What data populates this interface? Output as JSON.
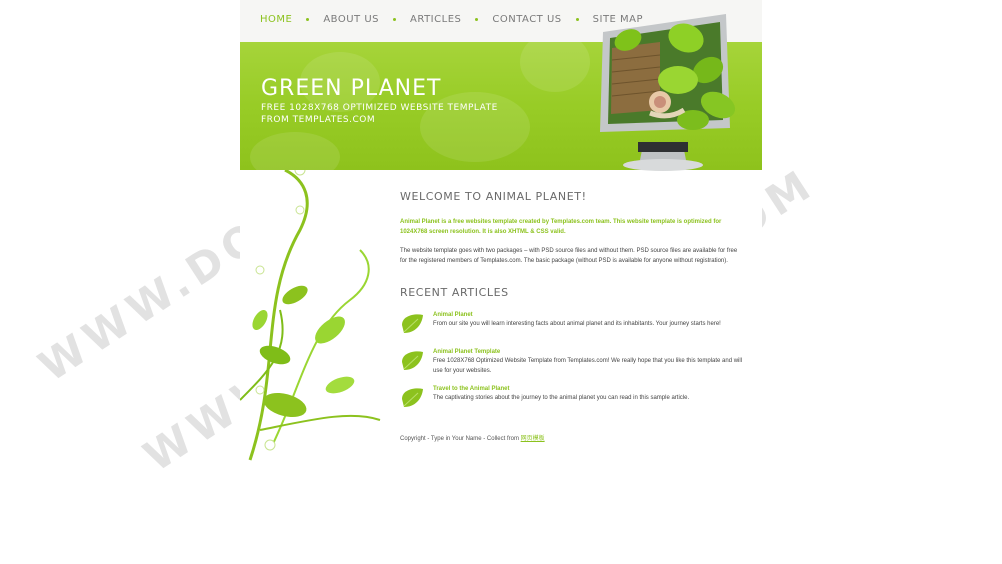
{
  "nav": {
    "items": [
      {
        "label": "HOME"
      },
      {
        "label": "ABOUT US"
      },
      {
        "label": "ARTICLES"
      },
      {
        "label": "CONTACT US"
      },
      {
        "label": "SITE MAP"
      }
    ]
  },
  "header": {
    "title": "GREEN PLANET",
    "subtitle_line1": "FREE 1028X768 OPTIMIZED WEBSITE TEMPLATE",
    "subtitle_line2": "FROM TEMPLATES.COM"
  },
  "welcome": {
    "heading": "WELCOME TO ANIMAL PLANET!",
    "intro": "Animal Planet is a free websites template created by Templates.com team. This website template is optimized for 1024X768 screen resolution. It is also XHTML & CSS valid.",
    "text": "The website template goes with two packages – with PSD source files and without them. PSD source files are available for free for the registered members of Templates.com. The basic package (without PSD is available for anyone without registration)."
  },
  "recent": {
    "heading": "RECENT ARTICLES",
    "articles": [
      {
        "title": "Animal Planet",
        "text": "From our site you will learn interesting facts about animal planet and its inhabitants. Your journey starts here!"
      },
      {
        "title": "Animal Planet Template",
        "text": "Free 1028X768 Optimized Website Template from Templates.com! We really hope that you like this template and will use for your websites."
      },
      {
        "title": "Travel to the Animal Planet",
        "text": "The captivating stories about the journey to the animal planet you can read in this sample article."
      }
    ]
  },
  "footer": {
    "text": "Copyright - Type in Your Name - Collect from ",
    "link": "网页模板"
  },
  "watermark": "WWW.DOWNDEMO.COM",
  "colors": {
    "accent": "#8cc21e",
    "header_bg": "#98cc26"
  }
}
